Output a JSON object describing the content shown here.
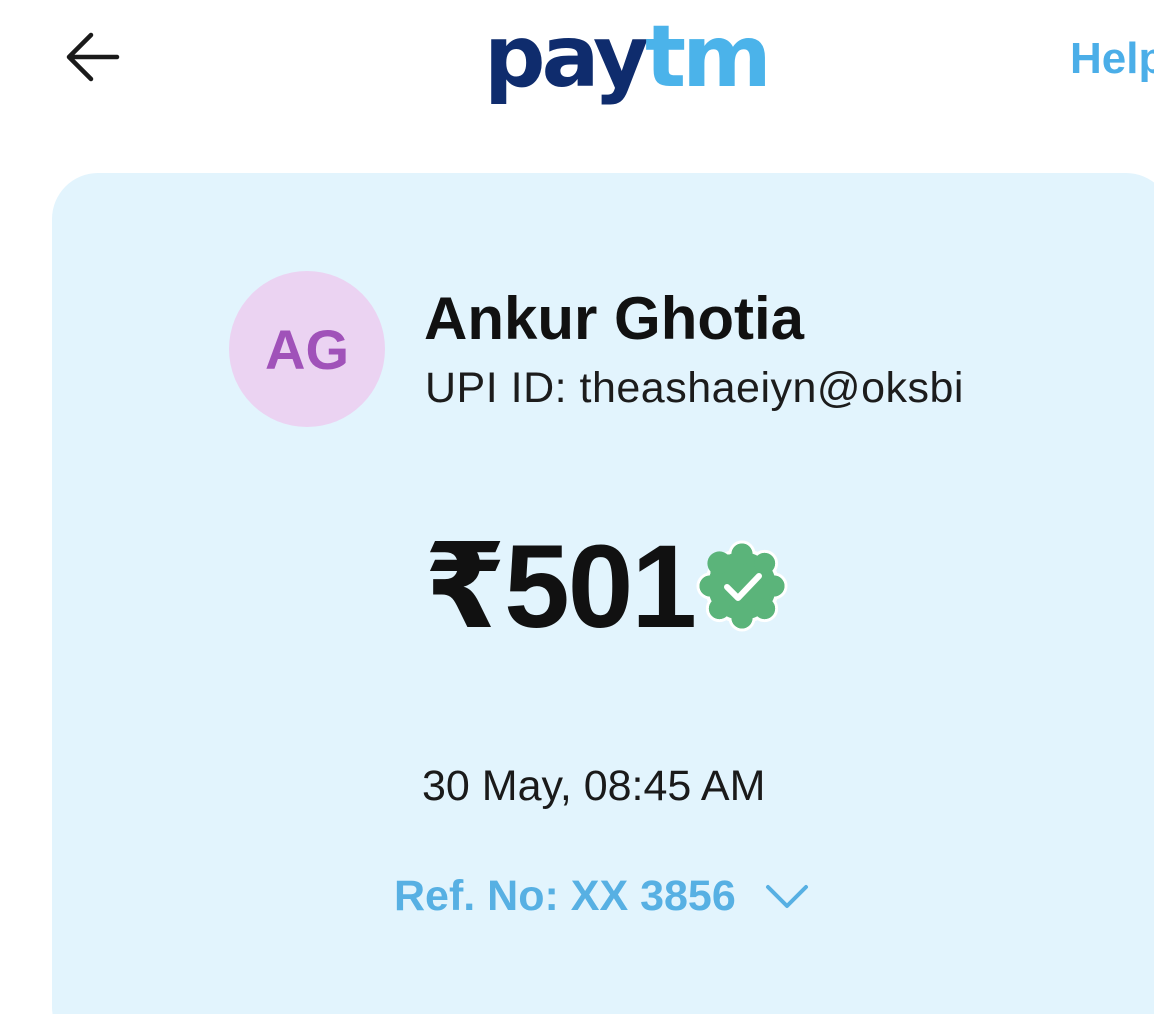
{
  "header": {
    "back_icon": "arrow-left-icon",
    "logo": {
      "part1": "pay",
      "part2": "tm",
      "color_pay": "#0f2c6d",
      "color_tm": "#4bb3ea"
    },
    "help_label": "Help"
  },
  "payee": {
    "initials": "AG",
    "name": "Ankur Ghotia",
    "upi_id": "UPI ID: theashaeiyn@oksbi"
  },
  "payment": {
    "amount": "₹501",
    "status_icon": "verified-check-icon",
    "status_color": "#5bb47a",
    "timestamp": "30 May, 08:45 AM",
    "reference": "Ref. No: XX 3856",
    "reference_icon": "chevron-down-icon"
  },
  "colors": {
    "card_background": "#e2f4fd",
    "accent": "#4baee8",
    "avatar_background": "#ebd3f2",
    "avatar_text": "#a052b9"
  }
}
